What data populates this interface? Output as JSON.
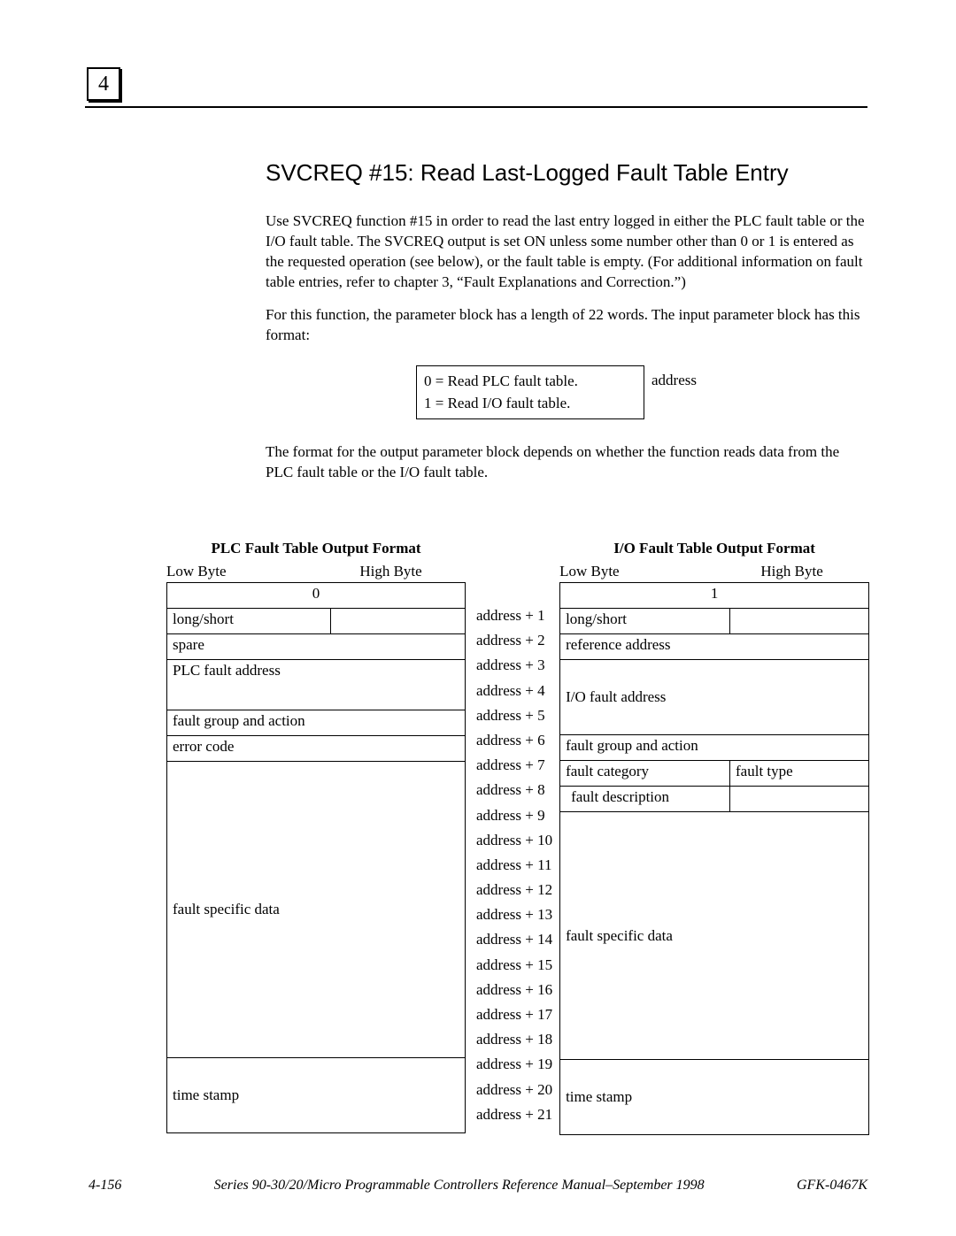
{
  "chapter": "4",
  "heading": "SVCREQ #15:  Read Last-Logged Fault Table Entry",
  "para1": "Use SVCREQ function #15 in order to read the last entry logged in either the PLC fault table or the I/O fault table.  The SVCREQ output is set ON unless some number other than 0 or 1 is entered as the requested operation (see below), or the fault table is empty.  (For additional information on fault table entries, refer to chapter 3, “Fault Explanations and Correction.”)",
  "para2": "For this function, the parameter block has a length of 22 words.  The input parameter block has this format:",
  "param_cell_line1": "0 = Read PLC fault table.",
  "param_cell_line2": "1 = Read I/O fault table.",
  "param_label": "address",
  "para3": "The format for the output parameter block depends on whether the function reads data from the PLC fault table or the I/O fault table.",
  "plc": {
    "title": "PLC Fault Table Output Format",
    "low": "Low Byte",
    "high": "High Byte",
    "row0": "0",
    "long_short": "long/short",
    "spare": "spare",
    "plc_fault_address": "PLC fault address",
    "fault_group_action": "fault group and action",
    "error_code": "error code",
    "fault_specific_data": "fault specific data",
    "time_stamp": "time stamp"
  },
  "io": {
    "title": "I/O Fault Table Output Format",
    "low": "Low Byte",
    "high": "High Byte",
    "row0": "1",
    "long_short": "long/short",
    "reference_address": "reference address",
    "io_fault_address": "I/O fault address",
    "fault_group_action": "fault group and action",
    "fault_category": "fault category",
    "fault_type": "fault type",
    "fault_description": "fault description",
    "fault_specific_data": "fault specific data",
    "time_stamp": "time stamp"
  },
  "addr": {
    "a1": "address + 1",
    "a2": "address + 2",
    "a3": "address + 3",
    "a4": "address + 4",
    "a5": "address + 5",
    "a6": "address + 6",
    "a7": "address + 7",
    "a8": "address + 8",
    "a9": "address + 9",
    "a10": "address + 10",
    "a11": "address + 11",
    "a12": "address + 12",
    "a13": "address + 13",
    "a14": "address + 14",
    "a15": "address + 15",
    "a16": "address + 16",
    "a17": "address + 17",
    "a18": "address + 18",
    "a19": "address + 19",
    "a20": "address + 20",
    "a21": "address + 21"
  },
  "footer": {
    "left": "4-156",
    "center": "Series 90-30/20/Micro Programmable Controllers Reference Manual–September 1998",
    "right": "GFK-0467K"
  }
}
